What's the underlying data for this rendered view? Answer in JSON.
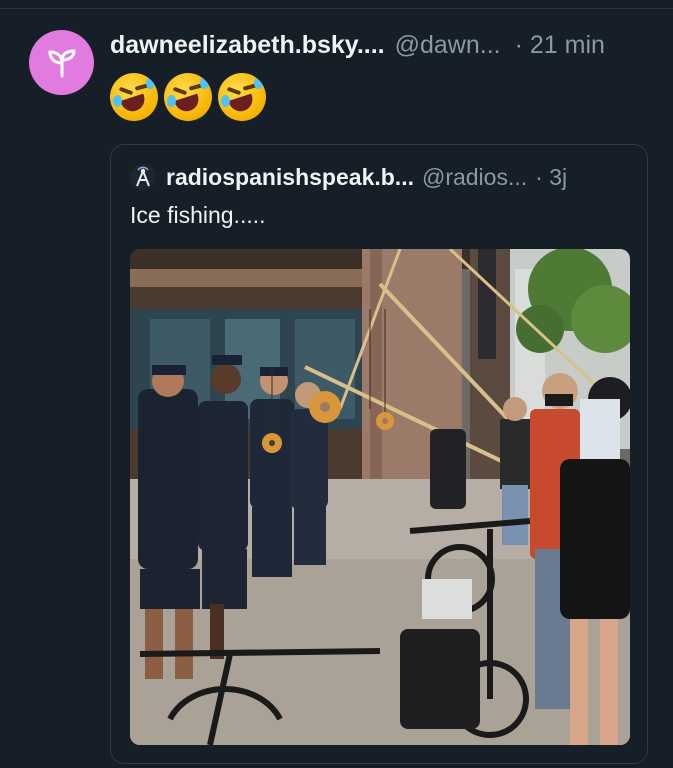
{
  "post": {
    "display_name": "dawneelizabeth.bsky....",
    "handle": "@dawn...",
    "time": "· 21 min",
    "avatar_icon": "sprout-icon",
    "avatar_color": "#e27be0",
    "content_emojis": [
      "rolling-on-floor-laughing",
      "rolling-on-floor-laughing",
      "rolling-on-floor-laughing"
    ]
  },
  "quote": {
    "display_name": "radiospanishspeak.b...",
    "handle": "@radios...",
    "time": "· 3j",
    "avatar_icon": "radio-tower-icon",
    "text": "Ice fishing.....",
    "image_icon": "photo-police-line-bagels-on-fishing-poles"
  },
  "colors": {
    "background": "#161e27",
    "primary_text": "#f1f3f5",
    "secondary_text": "#8a98a8",
    "border": "#2e3a48"
  }
}
